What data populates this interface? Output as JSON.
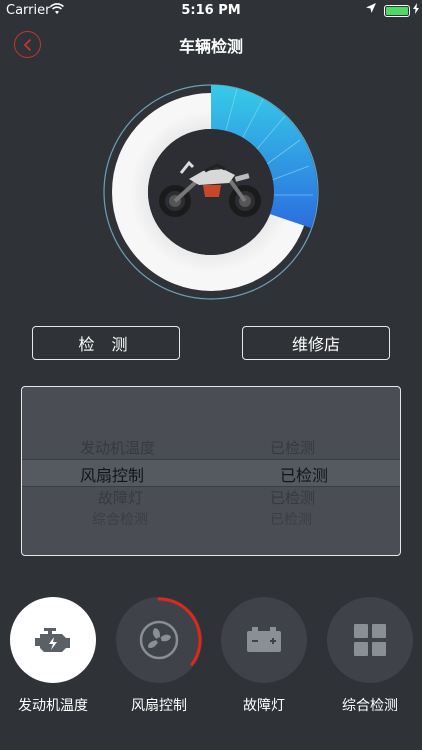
{
  "status_bar": {
    "carrier": "Carrier",
    "time": "5:16 PM"
  },
  "nav": {
    "title": "车辆检测"
  },
  "gauge": {
    "progress": 0.25,
    "accent_start": "#35c9e8",
    "accent_end": "#2c6fe0",
    "track_color": "#f1f1f1"
  },
  "actions": {
    "detect_label": "检 测",
    "repair_label": "维修店"
  },
  "picker": {
    "rows": [
      {
        "name": "发动机温度",
        "status": "已检测"
      },
      {
        "name": "风扇控制",
        "status": "已检测"
      },
      {
        "name": "故障灯",
        "status": "已检测"
      },
      {
        "name": "综合检测",
        "status": "已检测"
      }
    ],
    "selected_index": 1
  },
  "tabs": [
    {
      "label": "发动机温度",
      "icon": "engine-icon",
      "active": true
    },
    {
      "label": "风扇控制",
      "icon": "fan-icon",
      "active": false,
      "progress": 0.35,
      "progress_color": "#e0271b"
    },
    {
      "label": "故障灯",
      "icon": "battery-icon",
      "active": false
    },
    {
      "label": "综合检测",
      "icon": "grid-icon",
      "active": false
    }
  ]
}
